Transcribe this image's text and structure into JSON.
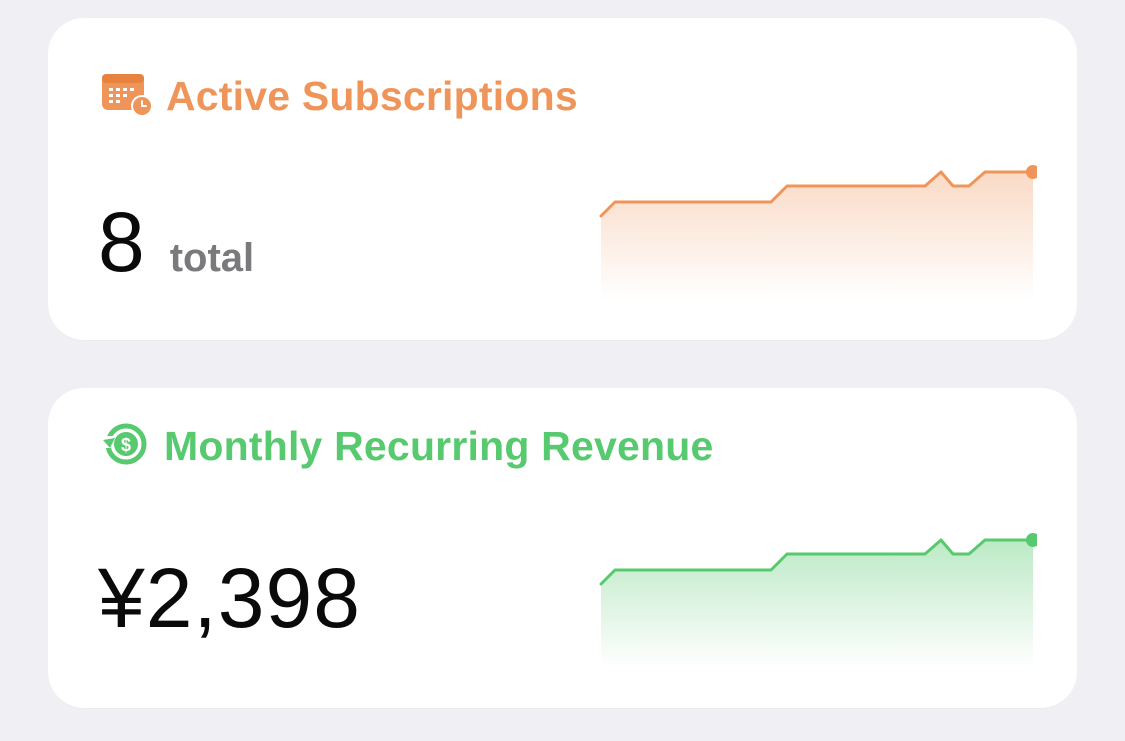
{
  "cards": {
    "subscriptions": {
      "title": "Active Subscriptions",
      "value": "8",
      "unit": "total",
      "icon": "calendar-clock-icon",
      "color": "#F0955A"
    },
    "mrr": {
      "title": "Monthly Recurring Revenue",
      "value": "¥2,398",
      "icon": "dollar-cycle-icon",
      "color": "#57C96E"
    }
  }
}
